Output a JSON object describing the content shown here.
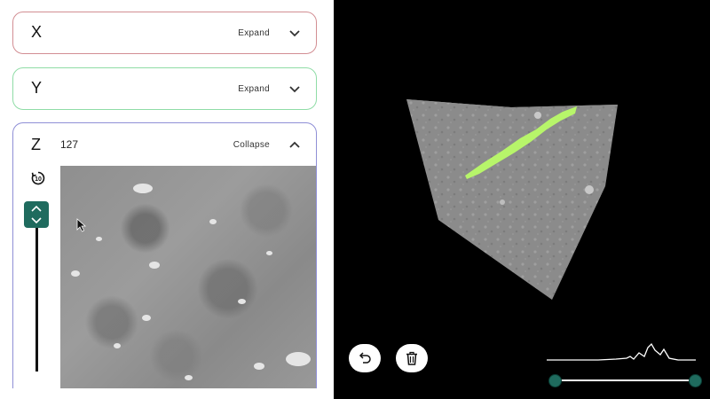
{
  "panels": {
    "x": {
      "label": "X",
      "toggle": "Expand"
    },
    "y": {
      "label": "Y",
      "toggle": "Expand"
    },
    "z": {
      "label": "Z",
      "slice": "127",
      "toggle": "Collapse"
    }
  },
  "colors": {
    "x_border": "#d28e93",
    "y_border": "#8fdca6",
    "z_border": "#8f8fd6",
    "accent": "#1f6b5e",
    "segmentation": "#b7f56a",
    "viewport_bg": "#000000"
  },
  "icons": {
    "reset": "rotate-reset-10-icon",
    "stepper": "up-down-chevron-icon",
    "undo": "undo-icon",
    "delete": "trash-icon",
    "expand": "chevron-down-icon",
    "collapse": "chevron-up-icon"
  },
  "z_slider": {
    "value_fraction": 0.0
  },
  "intensity_range": {
    "min_fraction": 0.0,
    "max_fraction": 1.0
  }
}
